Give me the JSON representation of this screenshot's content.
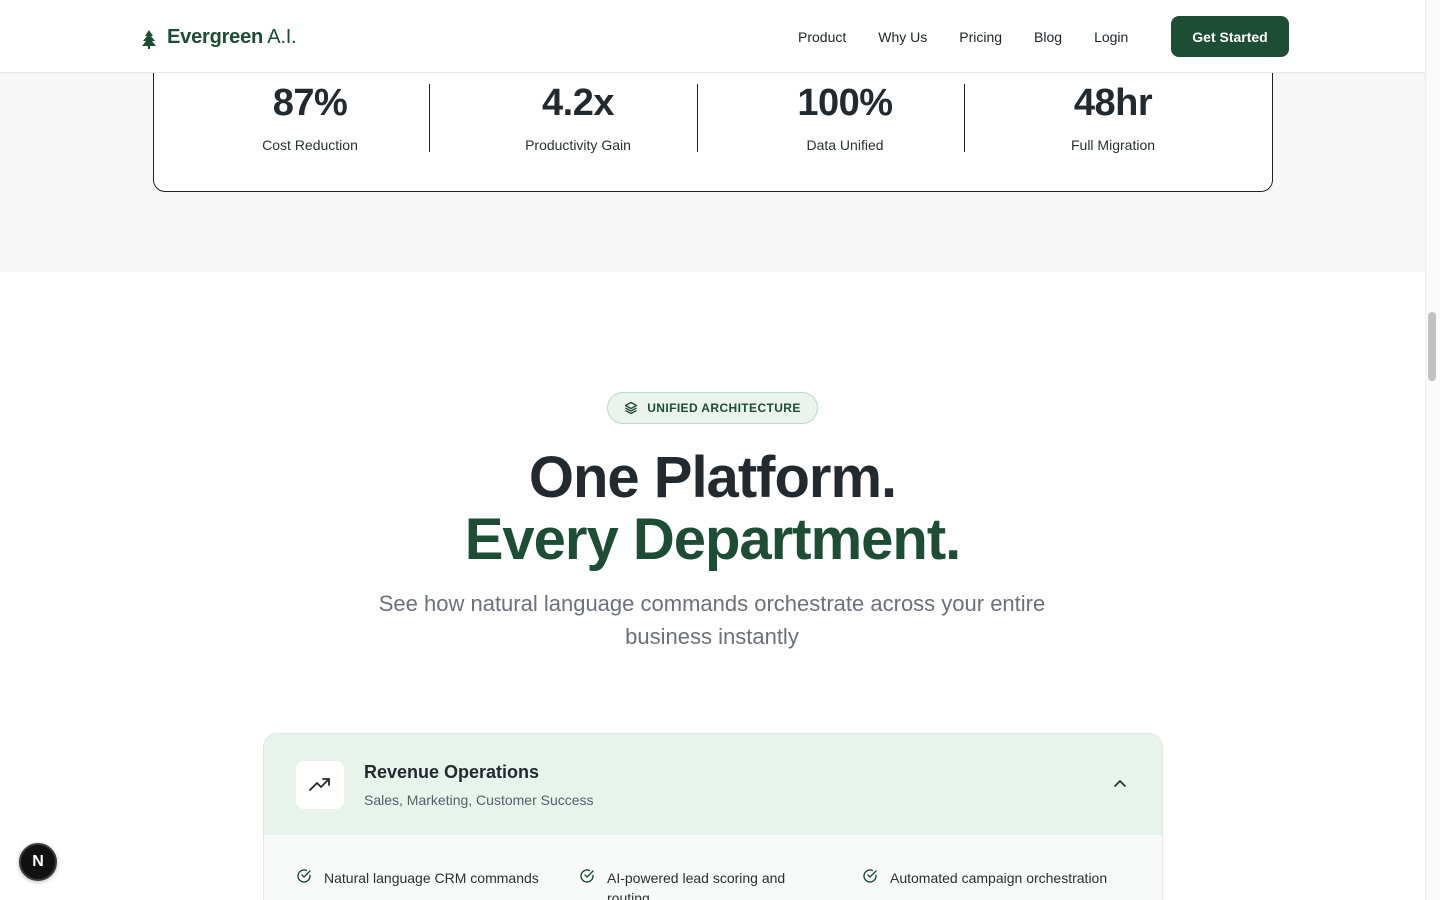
{
  "header": {
    "brand_bold": "Evergreen",
    "brand_rest": " A.I.",
    "nav": [
      "Product",
      "Why Us",
      "Pricing",
      "Blog",
      "Login"
    ],
    "cta": "Get Started"
  },
  "stats": [
    {
      "value": "87%",
      "label": "Cost Reduction"
    },
    {
      "value": "4.2x",
      "label": "Productivity Gain"
    },
    {
      "value": "100%",
      "label": "Data Unified"
    },
    {
      "value": "48hr",
      "label": "Full Migration"
    }
  ],
  "section": {
    "badge": "UNIFIED ARCHITECTURE",
    "title_line1": "One Platform.",
    "title_line2": "Every Department.",
    "subtitle": "See how natural language commands orchestrate across your entire business instantly"
  },
  "accordion": {
    "icon": "trending-up-icon",
    "title": "Revenue Operations",
    "subtitle": "Sales, Marketing, Customer Success",
    "features": [
      "Natural language CRM commands",
      "AI-powered lead scoring and routing",
      "Automated campaign orchestration"
    ]
  },
  "floating_badge": "N",
  "colors": {
    "brand": "#1d4d35",
    "badge_bg": "#eaf4ed",
    "accordion_head_bg": "#e7f3eb"
  }
}
